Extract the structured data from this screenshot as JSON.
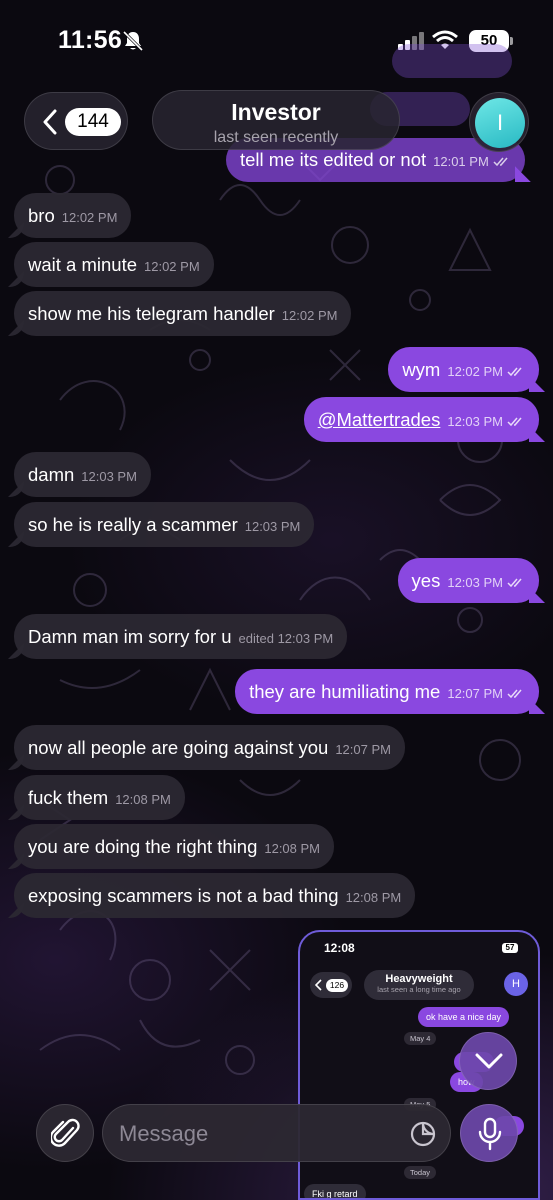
{
  "status_bar": {
    "time": "11:56",
    "battery": "50"
  },
  "header": {
    "unread_count": "144",
    "title": "Investor",
    "subtitle": "last seen recently",
    "avatar_initial": "I"
  },
  "faded_messages": [
    "tell me its edited or not",
    "12:01 PM"
  ],
  "messages": [
    {
      "dir": "in",
      "text": "bro",
      "time": "12:02 PM"
    },
    {
      "dir": "in",
      "text": "wait a minute",
      "time": "12:02 PM"
    },
    {
      "dir": "in",
      "text": "show me his telegram handler",
      "time": "12:02 PM"
    },
    {
      "dir": "out",
      "text": "wym",
      "time": "12:02 PM"
    },
    {
      "dir": "out",
      "text": "@Mattertrades",
      "time": "12:03 PM"
    },
    {
      "dir": "in",
      "text": "damn",
      "time": "12:03 PM"
    },
    {
      "dir": "in",
      "text": "so he is really a scammer",
      "time": "12:03 PM"
    },
    {
      "dir": "out",
      "text": "yes",
      "time": "12:03 PM"
    },
    {
      "dir": "in",
      "text": "Damn man im sorry for u",
      "time": "edited 12:03 PM"
    },
    {
      "dir": "out",
      "text": "they are humiliating me",
      "time": "12:07 PM"
    },
    {
      "dir": "in",
      "text": "now all people are going against you",
      "time": "12:07 PM"
    },
    {
      "dir": "in",
      "text": "fuck them",
      "time": "12:08 PM"
    },
    {
      "dir": "in",
      "text": "you are doing the right thing",
      "time": "12:08 PM"
    },
    {
      "dir": "in",
      "text": "exposing scammers is not a bad thing",
      "time": "12:08 PM"
    }
  ],
  "inset": {
    "time": "12:08",
    "battery": "57",
    "unread_count": "126",
    "title": "Heavyweight",
    "subtitle": "last seen a long time ago",
    "avatar_initial": "H",
    "bubble_1": "ok have a nice day",
    "date_1": "May 4",
    "bubble_2": "how",
    "date_2": "May 5",
    "date_3": "Today",
    "bubble_3": "Fki g retard"
  },
  "composer": {
    "placeholder": "Message"
  },
  "colors": {
    "outgoing_bubble": "#8a48e0",
    "incoming_bubble": "#2c2832",
    "accent": "#6f5cd9"
  },
  "icons": [
    "bell-slash-icon",
    "signal-icon",
    "wifi-icon",
    "chevron-left-icon",
    "double-check-icon",
    "chevron-down-icon",
    "paperclip-icon",
    "sticker-icon",
    "microphone-icon"
  ]
}
